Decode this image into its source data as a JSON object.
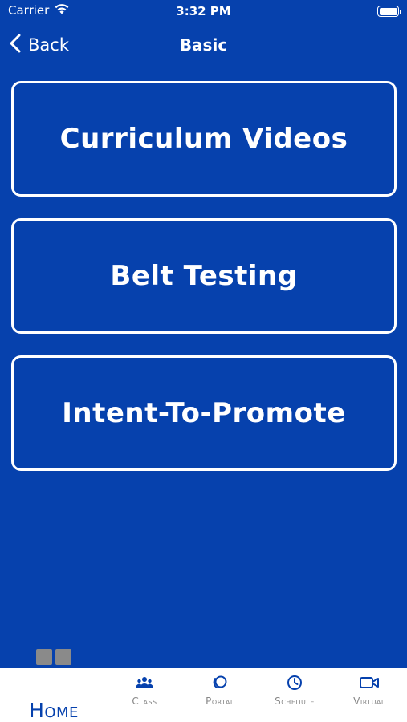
{
  "status_bar": {
    "carrier": "Carrier",
    "time": "3:32 PM"
  },
  "nav": {
    "back_label": "Back",
    "title": "Basic"
  },
  "menu": {
    "items": [
      {
        "label": "Curriculum Videos"
      },
      {
        "label": "Belt Testing"
      },
      {
        "label": "Intent-To-Promote"
      }
    ]
  },
  "tabs": {
    "home": {
      "label": "Home",
      "icon": "grid-icon"
    },
    "class": {
      "label": "Class",
      "icon": "group-icon"
    },
    "portal": {
      "label": "Portal",
      "icon": "portal-icon"
    },
    "schedule": {
      "label": "Schedule",
      "icon": "clock-icon"
    },
    "virtual": {
      "label": "Virtual",
      "icon": "video-icon"
    }
  },
  "colors": {
    "background": "#0641AD",
    "accent": "#0641AD",
    "tab_bar": "#ffffff",
    "tab_inactive": "#888888"
  }
}
